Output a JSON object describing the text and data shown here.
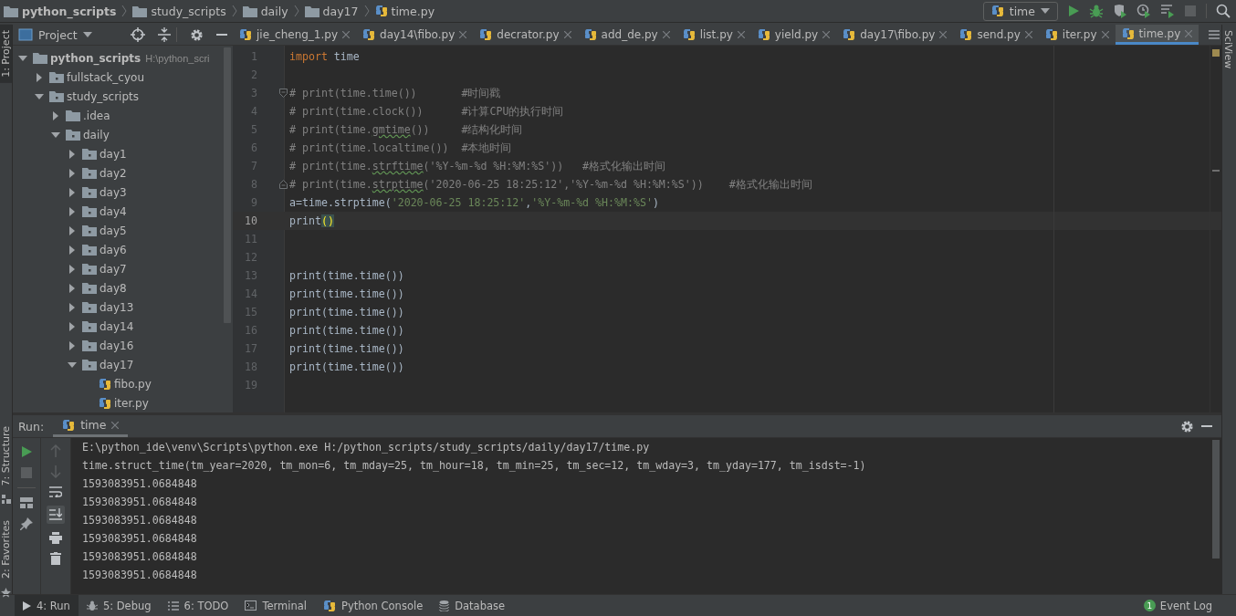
{
  "breadcrumb": [
    {
      "label": "python_scripts",
      "kind": "root"
    },
    {
      "label": "study_scripts",
      "kind": "folder"
    },
    {
      "label": "daily",
      "kind": "folder"
    },
    {
      "label": "day17",
      "kind": "folder"
    },
    {
      "label": "time.py",
      "kind": "file"
    }
  ],
  "run_config": {
    "label": "time"
  },
  "left_strip": {
    "top": [
      {
        "label": "1: Project",
        "selected": true
      }
    ],
    "bottom": [
      {
        "label": "7: Structure",
        "selected": false
      },
      {
        "label": "2: Favorites",
        "selected": false
      }
    ]
  },
  "right_strip": {
    "label": "SciView"
  },
  "project_panel": {
    "title": "Project",
    "tree": [
      {
        "label": "python_scripts",
        "path": "H:\\python_scri",
        "kind": "folder",
        "expanded": true,
        "children": [
          {
            "label": "fullstack_cyou",
            "kind": "package",
            "expanded": false
          },
          {
            "label": "study_scripts",
            "kind": "package",
            "expanded": true,
            "children": [
              {
                "label": ".idea",
                "kind": "folder",
                "expanded": false
              },
              {
                "label": "daily",
                "kind": "package",
                "expanded": true,
                "children": [
                  {
                    "label": "day1",
                    "kind": "package",
                    "expanded": false
                  },
                  {
                    "label": "day2",
                    "kind": "package",
                    "expanded": false
                  },
                  {
                    "label": "day3",
                    "kind": "package",
                    "expanded": false
                  },
                  {
                    "label": "day4",
                    "kind": "package",
                    "expanded": false
                  },
                  {
                    "label": "day5",
                    "kind": "package",
                    "expanded": false
                  },
                  {
                    "label": "day6",
                    "kind": "package",
                    "expanded": false
                  },
                  {
                    "label": "day7",
                    "kind": "package",
                    "expanded": false
                  },
                  {
                    "label": "day8",
                    "kind": "package",
                    "expanded": false
                  },
                  {
                    "label": "day13",
                    "kind": "package",
                    "expanded": false
                  },
                  {
                    "label": "day14",
                    "kind": "package",
                    "expanded": false
                  },
                  {
                    "label": "day16",
                    "kind": "package",
                    "expanded": false
                  },
                  {
                    "label": "day17",
                    "kind": "package",
                    "expanded": true,
                    "children": [
                      {
                        "label": "fibo.py",
                        "kind": "file"
                      },
                      {
                        "label": "iter.py",
                        "kind": "file"
                      }
                    ]
                  }
                ]
              }
            ]
          }
        ]
      }
    ]
  },
  "editor_tabs": [
    {
      "label": "jie_cheng_1.py",
      "selected": false
    },
    {
      "label": "day14\\fibo.py",
      "selected": false
    },
    {
      "label": "decrator.py",
      "selected": false
    },
    {
      "label": "add_de.py",
      "selected": false
    },
    {
      "label": "list.py",
      "selected": false
    },
    {
      "label": "yield.py",
      "selected": false
    },
    {
      "label": "day17\\fibo.py",
      "selected": false
    },
    {
      "label": "send.py",
      "selected": false
    },
    {
      "label": "iter.py",
      "selected": false
    },
    {
      "label": "time.py",
      "selected": true
    }
  ],
  "editor": {
    "lines": [
      {
        "num": "1",
        "current": false,
        "kind": "code",
        "segments": [
          {
            "kind": "keyword",
            "text": "import"
          },
          {
            "kind": "plain",
            "text": " time"
          }
        ]
      },
      {
        "num": "2",
        "current": false,
        "kind": "code"
      },
      {
        "num": "3",
        "current": false,
        "kind": "fold_start",
        "segments": [
          {
            "kind": "comment",
            "text": "# print(time.time())       #时间戳"
          }
        ]
      },
      {
        "num": "4",
        "current": false,
        "kind": "code",
        "segments": [
          {
            "kind": "comment",
            "text": "# print(time.clock())      #计算CPU的执行时间"
          }
        ]
      },
      {
        "num": "5",
        "current": false,
        "kind": "code",
        "segments": [
          {
            "kind": "comment",
            "text": "# print(time."
          },
          {
            "kind": "typo",
            "text": "gmtime"
          },
          {
            "kind": "comment",
            "text": "())     #结构化时间"
          }
        ]
      },
      {
        "num": "6",
        "current": false,
        "kind": "code",
        "segments": [
          {
            "kind": "comment",
            "text": "# print(time.localtime())  #本地时间"
          }
        ]
      },
      {
        "num": "7",
        "current": false,
        "kind": "code",
        "segments": [
          {
            "kind": "comment",
            "text": "# print(time."
          },
          {
            "kind": "typo",
            "text": "strftime"
          },
          {
            "kind": "comment",
            "text": "('%Y-%m-%d %H:%M:%S'))   #格式化输出时间"
          }
        ]
      },
      {
        "num": "8",
        "current": false,
        "kind": "fold_end",
        "segments": [
          {
            "kind": "comment",
            "text": "# print(time."
          },
          {
            "kind": "typo",
            "text": "strptime"
          },
          {
            "kind": "comment",
            "text": "('2020-06-25 18:25:12','%Y-%m-%d %H:%M:%S'))    #格式化输出时间"
          }
        ]
      },
      {
        "num": "9",
        "current": false,
        "kind": "code",
        "segments": [
          {
            "kind": "plain",
            "text": "a=time.strptime("
          },
          {
            "kind": "string",
            "text": "'2020-06-25 18:25:12'"
          },
          {
            "kind": "plain",
            "text": ","
          },
          {
            "kind": "string",
            "text": "'%Y-%m-%d %H:%M:%S'"
          },
          {
            "kind": "plain",
            "text": ")"
          }
        ]
      },
      {
        "num": "10",
        "current": true,
        "kind": "code",
        "segments": [
          {
            "kind": "plain",
            "text": "print"
          },
          {
            "kind": "paren",
            "text": "()"
          }
        ]
      },
      {
        "num": "11",
        "current": false,
        "kind": "code"
      },
      {
        "num": "12",
        "current": false,
        "kind": "code"
      },
      {
        "num": "13",
        "current": false,
        "kind": "code",
        "segments": [
          {
            "kind": "plain",
            "text": "print(time.time())"
          }
        ]
      },
      {
        "num": "14",
        "current": false,
        "kind": "code",
        "segments": [
          {
            "kind": "plain",
            "text": "print(time.time())"
          }
        ]
      },
      {
        "num": "15",
        "current": false,
        "kind": "code",
        "segments": [
          {
            "kind": "plain",
            "text": "print(time.time())"
          }
        ]
      },
      {
        "num": "16",
        "current": false,
        "kind": "code",
        "segments": [
          {
            "kind": "plain",
            "text": "print(time.time())"
          }
        ]
      },
      {
        "num": "17",
        "current": false,
        "kind": "code",
        "segments": [
          {
            "kind": "plain",
            "text": "print(time.time())"
          }
        ]
      },
      {
        "num": "18",
        "current": false,
        "kind": "code",
        "segments": [
          {
            "kind": "plain",
            "text": "print(time.time())"
          }
        ]
      },
      {
        "num": "19",
        "current": false,
        "kind": "code"
      }
    ]
  },
  "run_panel": {
    "label": "Run:",
    "tab": {
      "label": "time"
    },
    "output": [
      "E:\\python_ide\\venv\\Scripts\\python.exe H:/python_scripts/study_scripts/daily/day17/time.py",
      "time.struct_time(tm_year=2020, tm_mon=6, tm_mday=25, tm_hour=18, tm_min=25, tm_sec=12, tm_wday=3, tm_yday=177, tm_isdst=-1)",
      "1593083951.0684848",
      "1593083951.0684848",
      "1593083951.0684848",
      "1593083951.0684848",
      "1593083951.0684848",
      "1593083951.0684848"
    ]
  },
  "bottom_tabs": [
    {
      "label": "4: Run",
      "kind": "run",
      "selected": true
    },
    {
      "label": "5: Debug",
      "kind": "debug",
      "selected": false
    },
    {
      "label": "6: TODO",
      "kind": "todo",
      "selected": false
    },
    {
      "label": "Terminal",
      "kind": "terminal",
      "selected": false
    },
    {
      "label": "Python Console",
      "kind": "console",
      "selected": false
    },
    {
      "label": "Database",
      "kind": "database",
      "selected": false
    }
  ],
  "event_log": {
    "label": "Event Log",
    "count": "1"
  }
}
